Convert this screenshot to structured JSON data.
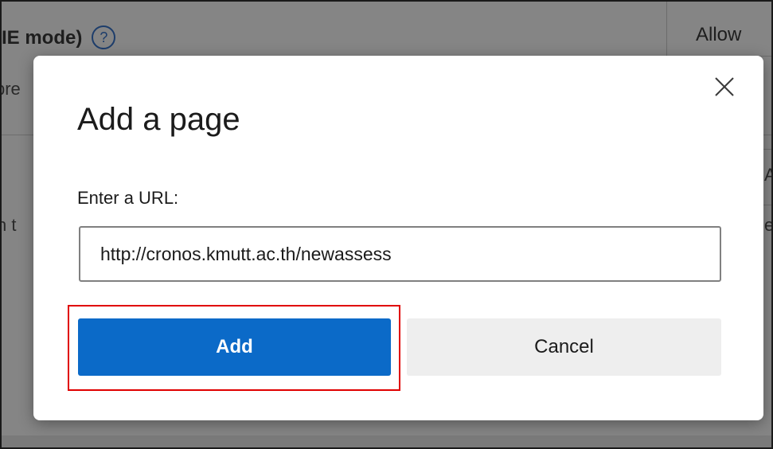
{
  "background": {
    "section_title": "IE mode)",
    "help_icon": "?",
    "allow_label": "Allow",
    "snippet_1": "pre",
    "snippet_2": "n t",
    "snippet_3": "A",
    "snippet_4": "er"
  },
  "dialog": {
    "title": "Add a page",
    "url_label": "Enter a URL:",
    "url_value": "http://cronos.kmutt.ac.th/newassess",
    "add_label": "Add",
    "cancel_label": "Cancel",
    "close_icon": "close-icon"
  },
  "colors": {
    "primary": "#0b6ac8",
    "highlight": "#e00000",
    "overlay": "#858585"
  }
}
